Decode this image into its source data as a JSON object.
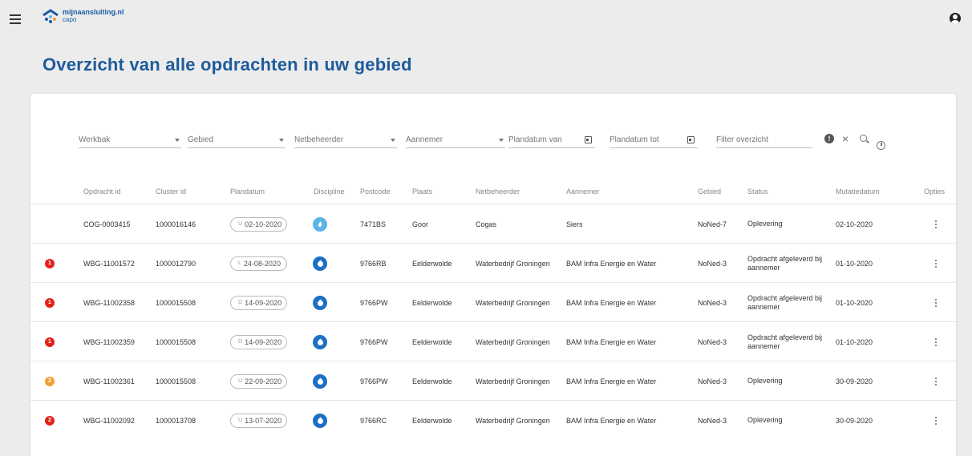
{
  "header": {
    "logo_line1": "mijnaansluiting.nl",
    "logo_line2": "capo"
  },
  "page_title": "Overzicht van alle opdrachten in uw gebied",
  "filters": {
    "werkbak": "Werkbak",
    "gebied": "Gebied",
    "netbeheerder": "Netbeheerder",
    "aannemer": "Aannemer",
    "plandatum_van": "Plandatum van",
    "plandatum_tot": "Plandatum tot",
    "filter_placeholder": "Filter overzicht"
  },
  "toolbar": {
    "alert_symbol": "!",
    "clear_symbol": "×"
  },
  "columns": {
    "opdracht_id": "Opdracht id",
    "cluster_id": "Cluster id",
    "plandatum": "Plandatum",
    "discipline": "Discipline",
    "postcode": "Postcode",
    "plaats": "Plaats",
    "netbeheerder": "Netbeheerder",
    "aannemer": "Aannemer",
    "gebied": "Gebied",
    "status": "Status",
    "mutatiedatum": "Mutatiedatum",
    "opties": "Opties"
  },
  "colors": {
    "title": "#1e5b9c",
    "badge_red": "#e2231a",
    "badge_orange": "#f0a030",
    "gas": "#5ab4e5",
    "water": "#1d6fc4"
  },
  "rows": [
    {
      "badge": "",
      "opdracht_id": "COG-0003415",
      "cluster_id": "1000016146",
      "code": "U",
      "plandatum": "02-10-2020",
      "discipline": "gas-icon",
      "postcode": "7471BS",
      "plaats": "Goor",
      "netbeheerder": "Cogas",
      "aannemer": "Siers",
      "gebied": "NoNed-7",
      "status": "Oplevering",
      "mutatiedatum": "02-10-2020"
    },
    {
      "badge": "1",
      "opdracht_id": "WBG-11001572",
      "cluster_id": "1000012790",
      "code": "L",
      "plandatum": "24-08-2020",
      "discipline": "water-icon",
      "postcode": "9766RB",
      "plaats": "Eelderwolde",
      "netbeheerder": "Waterbedrijf Groningen",
      "aannemer": "BAM Infra Energie en Water",
      "gebied": "NoNed-3",
      "status": "Opdracht afgeleverd bij aannemer",
      "mutatiedatum": "01-10-2020"
    },
    {
      "badge": "1",
      "opdracht_id": "WBG-11002358",
      "cluster_id": "1000015508",
      "code": "D",
      "plandatum": "14-09-2020",
      "discipline": "water-icon",
      "postcode": "9766PW",
      "plaats": "Eelderwolde",
      "netbeheerder": "Waterbedrijf Groningen",
      "aannemer": "BAM Infra Energie en Water",
      "gebied": "NoNed-3",
      "status": "Opdracht afgeleverd bij aannemer",
      "mutatiedatum": "01-10-2020"
    },
    {
      "badge": "1",
      "opdracht_id": "WBG-11002359",
      "cluster_id": "1000015508",
      "code": "D",
      "plandatum": "14-09-2020",
      "discipline": "water-icon",
      "postcode": "9766PW",
      "plaats": "Eelderwolde",
      "netbeheerder": "Waterbedrijf Groningen",
      "aannemer": "BAM Infra Energie en Water",
      "gebied": "NoNed-3",
      "status": "Opdracht afgeleverd bij aannemer",
      "mutatiedatum": "01-10-2020"
    },
    {
      "badge": "2",
      "opdracht_id": "WBG-11002361",
      "cluster_id": "1000015508",
      "code": "U",
      "plandatum": "22-09-2020",
      "discipline": "water-icon",
      "postcode": "9766PW",
      "plaats": "Eelderwolde",
      "netbeheerder": "Waterbedrijf Groningen",
      "aannemer": "BAM Infra Energie en Water",
      "gebied": "NoNed-3",
      "status": "Oplevering",
      "mutatiedatum": "30-09-2020"
    },
    {
      "badge": "2",
      "opdracht_id": "WBG-11002092",
      "cluster_id": "1000013708",
      "code": "U",
      "plandatum": "13-07-2020",
      "discipline": "water-icon",
      "postcode": "9766RC",
      "plaats": "Eelderwolde",
      "netbeheerder": "Waterbedrijf Groningen",
      "aannemer": "BAM Infra Energie en Water",
      "gebied": "NoNed-3",
      "status": "Oplevering",
      "mutatiedatum": "30-09-2020"
    }
  ]
}
